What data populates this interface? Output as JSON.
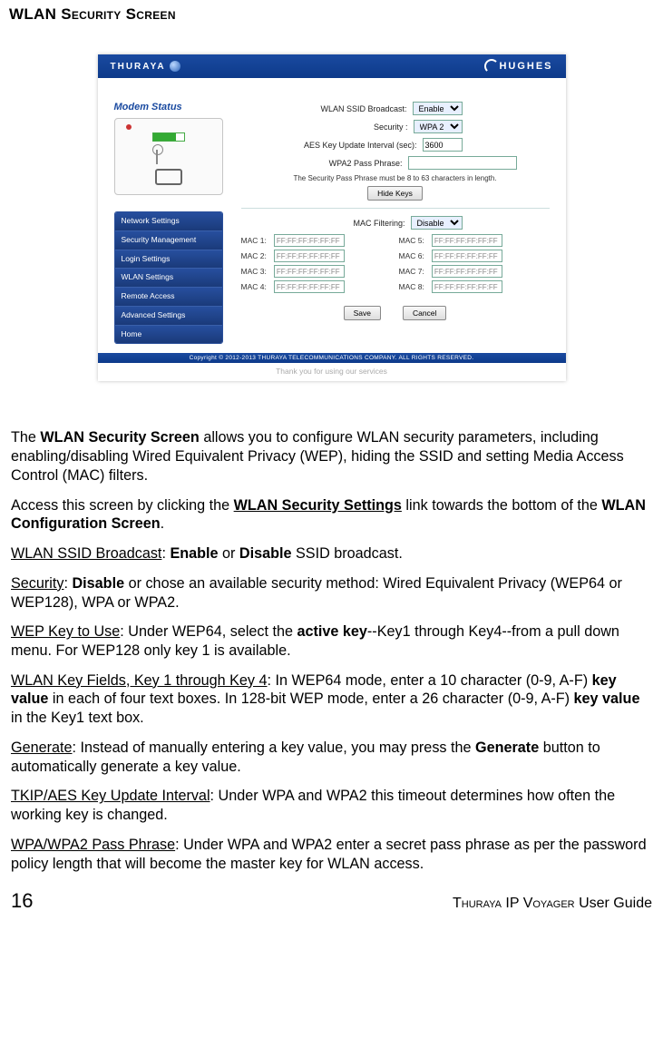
{
  "heading": "WLAN Security Screen",
  "screenshot": {
    "topbar": {
      "brand_left": "THURAYA",
      "brand_right": "HUGHES"
    },
    "modem_title": "Modem Status",
    "nav_items": [
      "Network Settings",
      "Security Management",
      "Login Settings",
      "WLAN Settings",
      "Remote Access",
      "Advanced Settings",
      "Home"
    ],
    "fields": {
      "ssid_label": "WLAN SSID Broadcast:",
      "ssid_value": "Enable",
      "security_label": "Security :",
      "security_value": "WPA 2",
      "aes_label": "AES Key Update Interval (sec):",
      "aes_value": "3600",
      "pass_label": "WPA2 Pass Phrase:",
      "pass_note": "The Security Pass Phrase must be 8 to 63 characters in length.",
      "hide_keys": "Hide Keys",
      "mac_filter_label": "MAC Filtering:",
      "mac_filter_value": "Disable",
      "mac_labels": {
        "m1": "MAC 1:",
        "m2": "MAC 2:",
        "m3": "MAC 3:",
        "m4": "MAC 4:",
        "m5": "MAC 5:",
        "m6": "MAC 6:",
        "m7": "MAC 7:",
        "m8": "MAC 8:"
      },
      "mac_placeholder": "FF:FF:FF:FF:FF:FF",
      "save": "Save",
      "cancel": "Cancel"
    },
    "copyright": "Copyright © 2012-2013 THURAYA TELECOMMUNICATIONS COMPANY. ALL RIGHTS RESERVED.",
    "thankyou": "Thank you for using our services"
  },
  "body": {
    "p1a": "The ",
    "p1b": "WLAN Security Screen",
    "p1c": " allows you to configure WLAN security parameters, including enabling/disabling Wired Equivalent Privacy (WEP), hiding the SSID and setting Media Access Control (MAC) filters.",
    "p2a": "Access this screen by clicking the ",
    "p2b": "WLAN Security Settings",
    "p2c": " link towards the bottom of the ",
    "p2d": "WLAN Configuration Screen",
    "p2e": ".",
    "p3a": "WLAN SSID Broadcast",
    "p3b": ":  ",
    "p3c": "Enable",
    "p3d": " or ",
    "p3e": "Disable",
    "p3f": " SSID broadcast.",
    "p4a": "Security",
    "p4b": ":  ",
    "p4c": "Disable",
    "p4d": " or chose an available security method: Wired Equivalent Privacy (WEP64 or WEP128), WPA or WPA2.",
    "p5a": "WEP Key to Use",
    "p5b": ":  Under WEP64, select the ",
    "p5c": "active key",
    "p5d": "--Key1 through Key4--from a pull down menu. For WEP128 only key 1 is available.",
    "p6a": "WLAN Key Fields, Key 1 through Key 4",
    "p6b": ":  In WEP64 mode, enter a 10 character (0-9, A-F) ",
    "p6c": "key value",
    "p6d": " in each of four text boxes.  In 128-bit WEP mode, enter a 26 character (0-9, A-F) ",
    "p6e": "key value",
    "p6f": " in the Key1 text box.",
    "p7a": "Generate",
    "p7b": ":  Instead of manually entering a key value, you may press the ",
    "p7c": "Generate",
    "p7d": " button to automatically generate a key value.",
    "p8a": "TKIP/AES Key Update Interval",
    "p8b": ": Under WPA and WPA2 this timeout determines how often the working key is changed.",
    "p9a": "WPA/WPA2 Pass Phrase",
    "p9b": ": Under WPA and WPA2 enter a secret pass phrase as per the password policy length that will become the master key for WLAN access."
  },
  "footer": {
    "page_number": "16",
    "title_prefix": "Thuraya IP Voyager",
    "title_suffix": " User Guide"
  }
}
